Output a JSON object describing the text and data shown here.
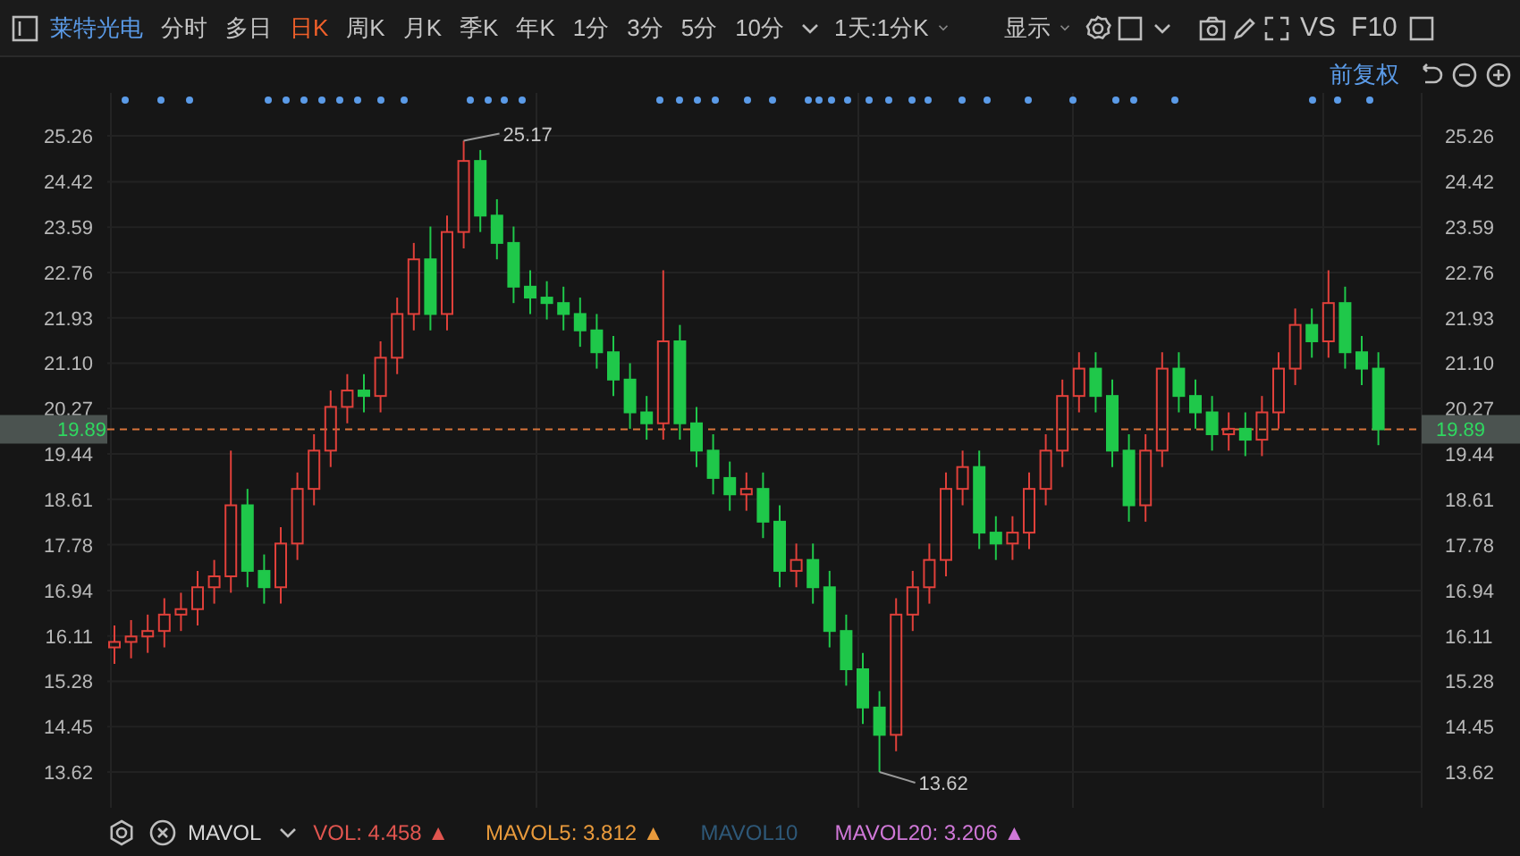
{
  "toolbar": {
    "stock_name": "莱特光电",
    "periods": [
      {
        "label": "分时",
        "selected": false
      },
      {
        "label": "多日",
        "selected": false
      },
      {
        "label": "日K",
        "selected": true
      },
      {
        "label": "周K",
        "selected": false
      },
      {
        "label": "月K",
        "selected": false
      },
      {
        "label": "季K",
        "selected": false
      },
      {
        "label": "年K",
        "selected": false
      },
      {
        "label": "1分",
        "selected": false
      },
      {
        "label": "3分",
        "selected": false
      },
      {
        "label": "5分",
        "selected": false
      },
      {
        "label": "10分",
        "selected": false
      }
    ],
    "dropdowns": [
      "1天:1分K",
      "显示"
    ],
    "text_buttons": [
      "VS",
      "F10"
    ]
  },
  "adjust_mode": "前复权",
  "chart": {
    "chart_data": {
      "type": "candlestick",
      "grid": true,
      "ylim": [
        13.62,
        25.26
      ],
      "yticks": [
        {
          "value": 25.26,
          "label": "25.26"
        },
        {
          "value": 24.42,
          "label": "24.42"
        },
        {
          "value": 23.59,
          "label": "23.59"
        },
        {
          "value": 22.76,
          "label": "22.76"
        },
        {
          "value": 21.93,
          "label": "21.93"
        },
        {
          "value": 21.1,
          "label": "21.10"
        },
        {
          "value": 20.27,
          "label": "20.27"
        },
        {
          "value": 19.44,
          "label": "19.44"
        },
        {
          "value": 18.61,
          "label": "18.61"
        },
        {
          "value": 17.78,
          "label": "17.78"
        },
        {
          "value": 16.94,
          "label": "16.94"
        },
        {
          "value": 16.11,
          "label": "16.11"
        },
        {
          "value": 15.28,
          "label": "15.28"
        },
        {
          "value": 14.45,
          "label": "14.45"
        },
        {
          "value": 13.62,
          "label": "13.62"
        }
      ],
      "ohlc": [
        [
          15.9,
          16.3,
          15.6,
          16.0
        ],
        [
          16.0,
          16.4,
          15.7,
          16.1
        ],
        [
          16.1,
          16.5,
          15.8,
          16.2
        ],
        [
          16.2,
          16.8,
          15.9,
          16.5
        ],
        [
          16.5,
          16.9,
          16.2,
          16.6
        ],
        [
          16.6,
          17.3,
          16.3,
          17.0
        ],
        [
          17.0,
          17.5,
          16.7,
          17.2
        ],
        [
          17.2,
          19.5,
          16.9,
          18.5
        ],
        [
          18.5,
          18.8,
          17.0,
          17.3
        ],
        [
          17.3,
          17.6,
          16.7,
          17.0
        ],
        [
          17.0,
          18.1,
          16.7,
          17.8
        ],
        [
          17.8,
          19.1,
          17.5,
          18.8
        ],
        [
          18.8,
          19.8,
          18.5,
          19.5
        ],
        [
          19.5,
          20.6,
          19.2,
          20.3
        ],
        [
          20.3,
          20.9,
          20.0,
          20.6
        ],
        [
          20.6,
          20.9,
          20.2,
          20.5
        ],
        [
          20.5,
          21.5,
          20.2,
          21.2
        ],
        [
          21.2,
          22.3,
          20.9,
          22.0
        ],
        [
          22.0,
          23.3,
          21.7,
          23.0
        ],
        [
          23.0,
          23.6,
          21.7,
          22.0
        ],
        [
          22.0,
          23.8,
          21.7,
          23.5
        ],
        [
          23.5,
          25.17,
          23.2,
          24.8
        ],
        [
          24.8,
          25.0,
          23.5,
          23.8
        ],
        [
          23.8,
          24.1,
          23.0,
          23.3
        ],
        [
          23.3,
          23.6,
          22.2,
          22.5
        ],
        [
          22.5,
          22.8,
          22.0,
          22.3
        ],
        [
          22.3,
          22.6,
          21.9,
          22.2
        ],
        [
          22.2,
          22.5,
          21.7,
          22.0
        ],
        [
          22.0,
          22.3,
          21.4,
          21.7
        ],
        [
          21.7,
          22.0,
          21.0,
          21.3
        ],
        [
          21.3,
          21.6,
          20.5,
          20.8
        ],
        [
          20.8,
          21.1,
          19.9,
          20.2
        ],
        [
          20.2,
          20.5,
          19.7,
          20.0
        ],
        [
          20.0,
          22.8,
          19.7,
          21.5
        ],
        [
          21.5,
          21.8,
          19.7,
          20.0
        ],
        [
          20.0,
          20.3,
          19.2,
          19.5
        ],
        [
          19.5,
          19.8,
          18.7,
          19.0
        ],
        [
          19.0,
          19.3,
          18.4,
          18.7
        ],
        [
          18.7,
          19.1,
          18.4,
          18.8
        ],
        [
          18.8,
          19.1,
          17.9,
          18.2
        ],
        [
          18.2,
          18.5,
          17.0,
          17.3
        ],
        [
          17.3,
          17.8,
          17.0,
          17.5
        ],
        [
          17.5,
          17.8,
          16.7,
          17.0
        ],
        [
          17.0,
          17.3,
          15.9,
          16.2
        ],
        [
          16.2,
          16.5,
          15.2,
          15.5
        ],
        [
          15.5,
          15.8,
          14.5,
          14.8
        ],
        [
          14.8,
          15.1,
          13.62,
          14.3
        ],
        [
          14.3,
          16.8,
          14.0,
          16.5
        ],
        [
          16.5,
          17.3,
          16.2,
          17.0
        ],
        [
          17.0,
          17.8,
          16.7,
          17.5
        ],
        [
          17.5,
          19.1,
          17.2,
          18.8
        ],
        [
          18.8,
          19.5,
          18.5,
          19.2
        ],
        [
          19.2,
          19.5,
          17.7,
          18.0
        ],
        [
          18.0,
          18.3,
          17.5,
          17.8
        ],
        [
          17.8,
          18.3,
          17.5,
          18.0
        ],
        [
          18.0,
          19.1,
          17.7,
          18.8
        ],
        [
          18.8,
          19.8,
          18.5,
          19.5
        ],
        [
          19.5,
          20.8,
          19.2,
          20.5
        ],
        [
          20.5,
          21.3,
          20.2,
          21.0
        ],
        [
          21.0,
          21.3,
          20.2,
          20.5
        ],
        [
          20.5,
          20.8,
          19.2,
          19.5
        ],
        [
          19.5,
          19.8,
          18.2,
          18.5
        ],
        [
          18.5,
          19.8,
          18.2,
          19.5
        ],
        [
          19.5,
          21.3,
          19.2,
          21.0
        ],
        [
          21.0,
          21.3,
          20.2,
          20.5
        ],
        [
          20.5,
          20.8,
          19.9,
          20.2
        ],
        [
          20.2,
          20.5,
          19.5,
          19.8
        ],
        [
          19.8,
          20.2,
          19.5,
          19.9
        ],
        [
          19.9,
          20.2,
          19.4,
          19.7
        ],
        [
          19.7,
          20.5,
          19.4,
          20.2
        ],
        [
          20.2,
          21.3,
          19.9,
          21.0
        ],
        [
          21.0,
          22.1,
          20.7,
          21.8
        ],
        [
          21.8,
          22.1,
          21.2,
          21.5
        ],
        [
          21.5,
          22.8,
          21.2,
          22.2
        ],
        [
          22.2,
          22.5,
          21.0,
          21.3
        ],
        [
          21.3,
          21.6,
          20.7,
          21.0
        ],
        [
          21.0,
          21.3,
          19.6,
          19.89
        ]
      ],
      "annotations": [
        "25.17",
        "13.62"
      ],
      "ref_lines": [
        {
          "axis": "y",
          "value": 19.89,
          "label": "19.89",
          "color": "#d8743a"
        }
      ]
    },
    "right_axis_labels": [
      "25.26",
      "24.42",
      "23.59",
      "22.76",
      "21.93",
      "21.10",
      "20.27",
      "19.44",
      "18.61",
      "17.78",
      "16.94",
      "16.11",
      "15.28",
      "14.45",
      "13.62"
    ],
    "right_price_label": "19.89"
  },
  "indicator_bar": {
    "name": "MAVOL",
    "values": [
      {
        "label": "VOL:",
        "value": "4.458",
        "arrow": "▲",
        "color": "#e0554f"
      },
      {
        "label": "MAVOL5:",
        "value": "3.812",
        "arrow": "▲",
        "color": "#e89a3c"
      },
      {
        "label": "MAVOL10",
        "color": "#2e5878"
      },
      {
        "label": "MAVOL20:",
        "value": "3.206",
        "arrow": "▲",
        "color": "#d078d8"
      }
    ]
  }
}
